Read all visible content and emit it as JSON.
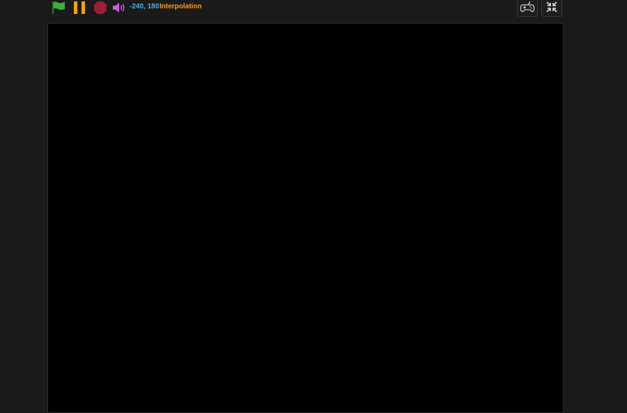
{
  "toolbar": {
    "green_flag_icon": "green-flag-icon",
    "pause_icon": "pause-icon",
    "stop_icon": "stop-icon",
    "volume_icon": "volume-icon",
    "mouse_coordinates": "-240, 180",
    "interpolation_label": "Interpolation",
    "gamepad_icon": "gamepad-icon",
    "fullscreen_icon": "exit-fullscreen-icon"
  },
  "colors": {
    "flag": "#3fae3a",
    "pause": "#f5a200",
    "stop": "#9a1f35",
    "volume": "#c95fd8",
    "coordinates": "#4fb3e8",
    "interpolation": "#ff9c1a",
    "stage_background": "#000000",
    "page_background": "#1a1a1a"
  }
}
